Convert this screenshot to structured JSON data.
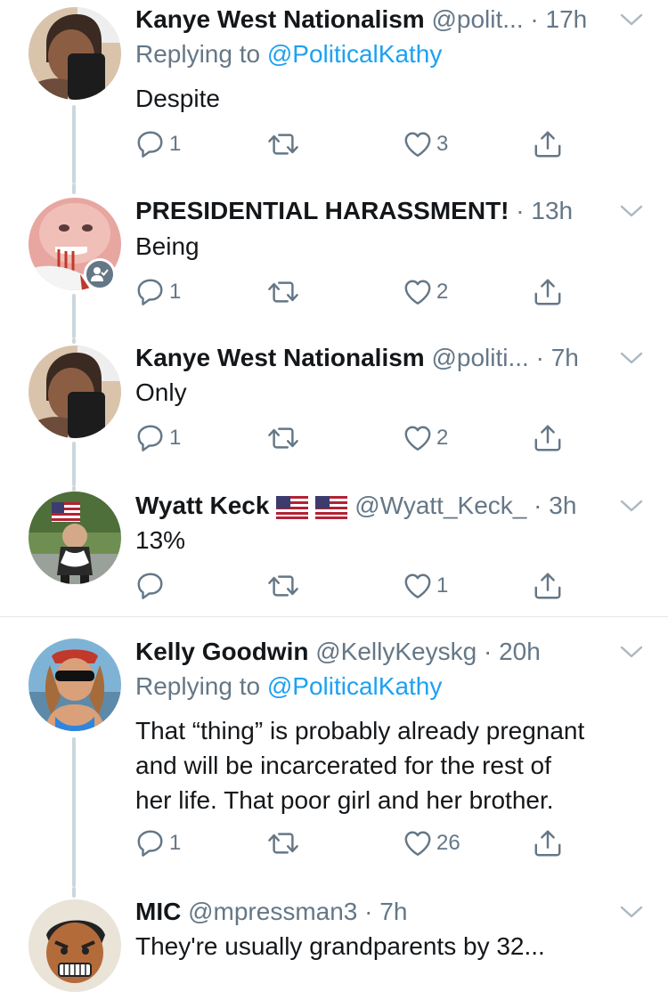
{
  "tweets": [
    {
      "name": "Kanye West Nationalism",
      "handle": "@polit...",
      "dot": "·",
      "time": "17h",
      "reply_prefix": "Replying to ",
      "reply_to": "@PoliticalKathy",
      "text": "Despite",
      "replies": "1",
      "retweets": "",
      "likes": "3"
    },
    {
      "name": "PRESIDENTIAL HARASSMENT!",
      "handle": "",
      "dot": "·",
      "time": "13h",
      "text": "Being",
      "replies": "1",
      "retweets": "",
      "likes": "2"
    },
    {
      "name": "Kanye West Nationalism",
      "handle": "@politi...",
      "dot": "·",
      "time": "7h",
      "text": "Only",
      "replies": "1",
      "retweets": "",
      "likes": "2"
    },
    {
      "name": "Wyatt Keck",
      "handle": "@Wyatt_Keck_",
      "dot": "·",
      "time": "3h",
      "text": "13%",
      "replies": "",
      "retweets": "",
      "likes": "1"
    },
    {
      "name": "Kelly Goodwin",
      "handle": "@KellyKeyskg",
      "dot": "·",
      "time": "20h",
      "reply_prefix": "Replying to ",
      "reply_to": "@PoliticalKathy",
      "text_lines": [
        "That “thing” is probably already pregnant",
        "and will be incarcerated for the rest of",
        "her life. That poor girl and her brother."
      ],
      "replies": "1",
      "retweets": "",
      "likes": "26"
    },
    {
      "name": "MIC",
      "handle": "@mpressman3",
      "dot": "·",
      "time": "7h",
      "text": "They're usually grandparents by 32..."
    }
  ],
  "colors": {
    "text": "#14171a",
    "secondary": "#657786",
    "link": "#1da1f2",
    "thread_line": "#ccd6dd",
    "divider": "#e1e8ed"
  },
  "icons": [
    "reply-icon",
    "retweet-icon",
    "like-icon",
    "share-icon",
    "chevron-down-icon",
    "us-flag-icon"
  ]
}
